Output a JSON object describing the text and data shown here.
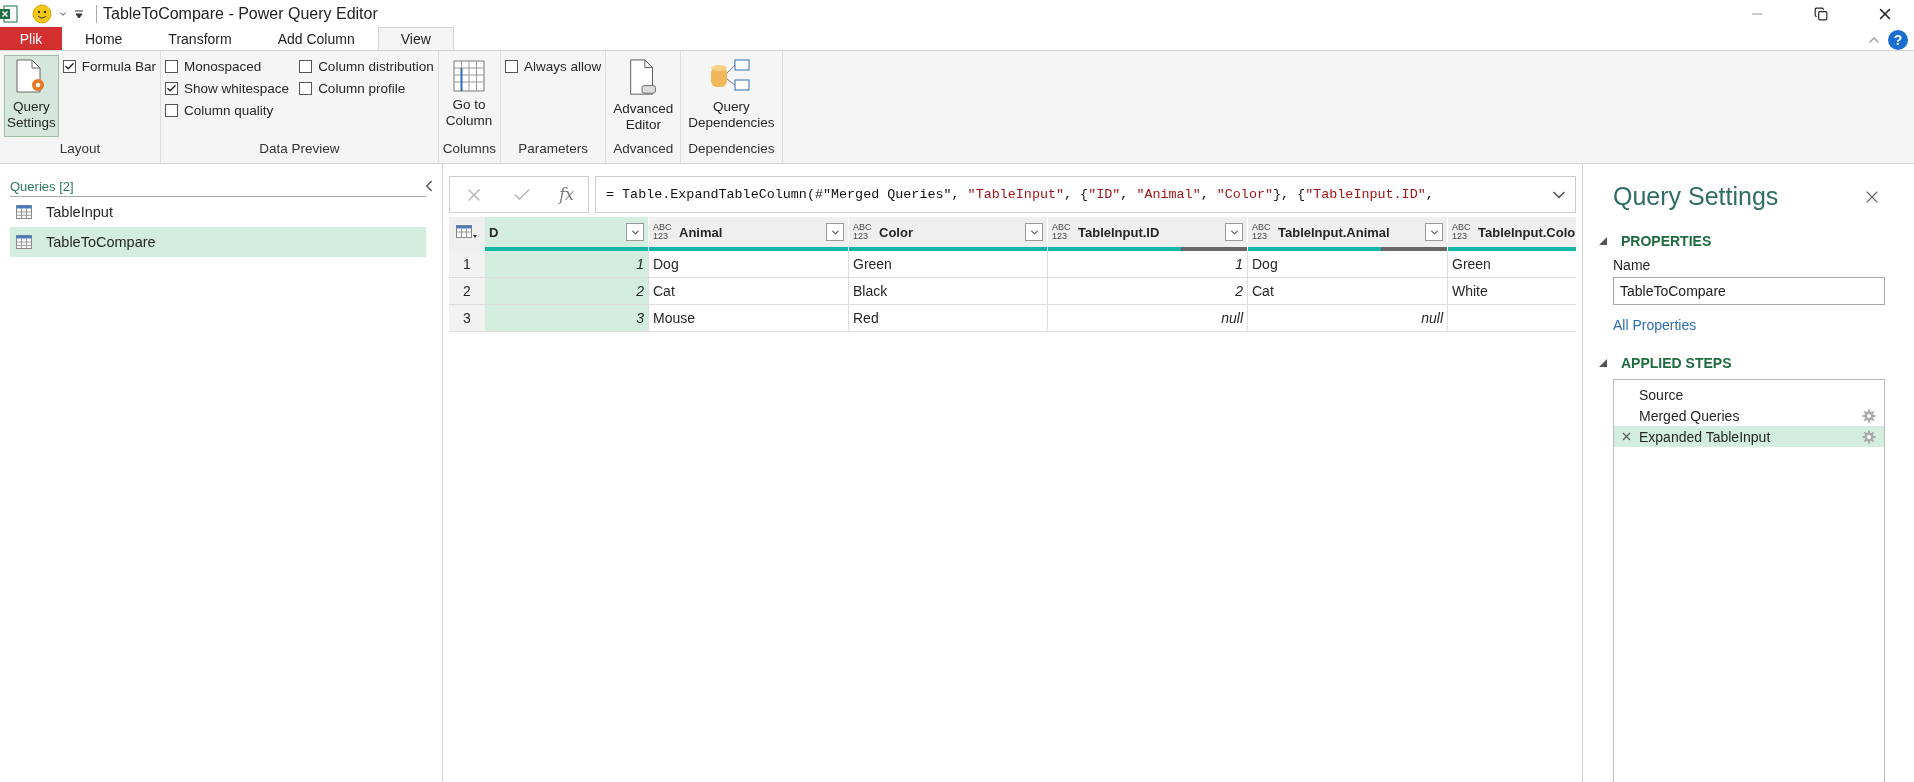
{
  "title_bar": {
    "title": "TableToCompare - Power Query Editor",
    "help": "?"
  },
  "ribbon_tabs": [
    {
      "label": "Plik",
      "kind": "file",
      "selected": false
    },
    {
      "label": "Home",
      "kind": "tab",
      "selected": false
    },
    {
      "label": "Transform",
      "kind": "tab",
      "selected": false
    },
    {
      "label": "Add Column",
      "kind": "tab",
      "selected": false
    },
    {
      "label": "View",
      "kind": "tab",
      "selected": true
    }
  ],
  "ribbon_groups": [
    {
      "label": "Layout",
      "items": [
        {
          "kind": "large",
          "label": "Query\nSettings",
          "selected": true
        },
        {
          "kind": "checkbox",
          "label": "Formula Bar",
          "checked": true
        }
      ]
    },
    {
      "label": "Data Preview",
      "items": [
        {
          "kind": "checkbox",
          "label": "Monospaced",
          "checked": false
        },
        {
          "kind": "checkbox",
          "label": "Show whitespace",
          "checked": true
        },
        {
          "kind": "checkbox",
          "label": "Column quality",
          "checked": false
        },
        {
          "kind": "checkbox",
          "label": "Column distribution",
          "checked": false
        },
        {
          "kind": "checkbox",
          "label": "Column profile",
          "checked": false
        }
      ]
    },
    {
      "label": "Columns",
      "items": [
        {
          "kind": "large",
          "label": "Go to\nColumn",
          "selected": false
        }
      ]
    },
    {
      "label": "Parameters",
      "items": [
        {
          "kind": "checkbox",
          "label": "Always allow",
          "checked": false
        }
      ]
    },
    {
      "label": "Advanced",
      "items": [
        {
          "kind": "large",
          "label": "Advanced\nEditor",
          "selected": false
        }
      ]
    },
    {
      "label": "Dependencies",
      "items": [
        {
          "kind": "large",
          "label": "Query\nDependencies",
          "selected": false
        }
      ]
    }
  ],
  "queries": {
    "header": "Queries [2]",
    "items": [
      {
        "label": "TableInput",
        "selected": false
      },
      {
        "label": "TableToCompare",
        "selected": true
      }
    ]
  },
  "formula_bar": {
    "fx": "fx",
    "tokens": [
      {
        "kind": "plain",
        "text": "= Table.ExpandTableColumn(#\"Merged Queries\", "
      },
      {
        "kind": "string",
        "text": "\"TableInput\""
      },
      {
        "kind": "plain",
        "text": ", {"
      },
      {
        "kind": "string",
        "text": "\"ID\""
      },
      {
        "kind": "plain",
        "text": ", "
      },
      {
        "kind": "string",
        "text": "\"Animal\""
      },
      {
        "kind": "plain",
        "text": ", "
      },
      {
        "kind": "string",
        "text": "\"Color\""
      },
      {
        "kind": "plain",
        "text": "}, {"
      },
      {
        "kind": "string",
        "text": "\"TableInput.ID\""
      },
      {
        "kind": "plain",
        "text": ","
      }
    ]
  },
  "table": {
    "columns": [
      {
        "name": "D",
        "selected": true,
        "level": 1,
        "filter": true
      },
      {
        "name": "Animal",
        "type": "ABC 123",
        "selected": false,
        "level": 1,
        "filter": true
      },
      {
        "name": "Color",
        "type": "ABC 123",
        "selected": false,
        "level": 1,
        "filter": true
      },
      {
        "name": "TableInput.ID",
        "type": "ABC 123",
        "selected": false,
        "level": 0.67,
        "filter": true
      },
      {
        "name": "TableInput.Animal",
        "type": "ABC 123",
        "selected": false,
        "level": 0.67,
        "filter": true
      },
      {
        "name": "TableInput.Colo",
        "type": "ABC 123",
        "selected": false,
        "level": 1,
        "filter": false
      }
    ],
    "rows": [
      {
        "number": "1",
        "cells": [
          {
            "kind": "number",
            "text": "1"
          },
          {
            "kind": "text",
            "text": "Dog"
          },
          {
            "kind": "text",
            "text": "Green"
          },
          {
            "kind": "number",
            "text": "1"
          },
          {
            "kind": "text",
            "text": "Dog"
          },
          {
            "kind": "text",
            "text": "Green"
          }
        ]
      },
      {
        "number": "2",
        "cells": [
          {
            "kind": "number",
            "text": "2"
          },
          {
            "kind": "text",
            "text": "Cat"
          },
          {
            "kind": "text",
            "text": "Black"
          },
          {
            "kind": "number",
            "text": "2"
          },
          {
            "kind": "text",
            "text": "Cat"
          },
          {
            "kind": "text",
            "text": "White"
          }
        ]
      },
      {
        "number": "3",
        "cells": [
          {
            "kind": "number",
            "text": "3"
          },
          {
            "kind": "text",
            "text": "Mouse"
          },
          {
            "kind": "text",
            "text": "Red"
          },
          {
            "kind": "null",
            "text": "null"
          },
          {
            "kind": "null",
            "text": "null"
          },
          null
        ]
      }
    ]
  },
  "query_settings": {
    "title": "Query Settings",
    "properties_header": "PROPERTIES",
    "name_label": "Name",
    "name_value": "TableToCompare",
    "all_properties": "All Properties",
    "steps_header": "APPLIED STEPS",
    "steps": [
      {
        "label": "Source",
        "gear": false,
        "selected": false
      },
      {
        "label": "Merged Queries",
        "gear": true,
        "selected": false
      },
      {
        "label": "Expanded TableInput",
        "gear": true,
        "selected": true
      }
    ]
  }
}
